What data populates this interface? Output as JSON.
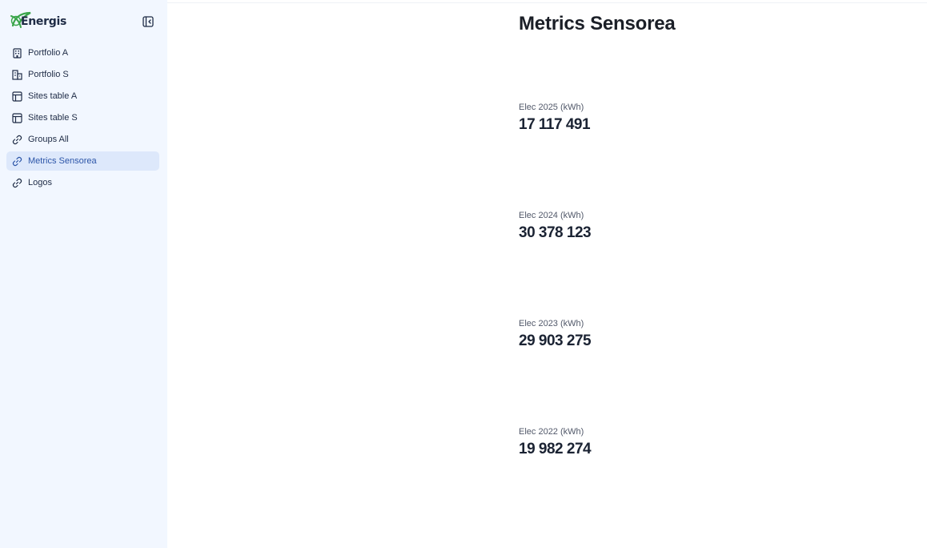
{
  "brand": {
    "name": "Energis"
  },
  "sidebar": {
    "items": [
      {
        "label": "Portfolio A",
        "icon": "building-icon",
        "active": false
      },
      {
        "label": "Portfolio S",
        "icon": "buildings-icon",
        "active": false
      },
      {
        "label": "Sites table A",
        "icon": "table-icon",
        "active": false
      },
      {
        "label": "Sites table S",
        "icon": "table-icon",
        "active": false
      },
      {
        "label": "Groups All",
        "icon": "link-icon",
        "active": false
      },
      {
        "label": "Metrics Sensorea",
        "icon": "link-icon",
        "active": true
      },
      {
        "label": "Logos",
        "icon": "link-icon",
        "active": false
      }
    ]
  },
  "main": {
    "title": "Metrics Sensorea",
    "metrics": [
      {
        "label": "Elec 2025 (kWh)",
        "value": "17 117 491"
      },
      {
        "label": "Elec 2024 (kWh)",
        "value": "30 378 123"
      },
      {
        "label": "Elec 2023 (kWh)",
        "value": "29 903 275"
      },
      {
        "label": "Elec 2022 (kWh)",
        "value": "19 982 274"
      }
    ]
  },
  "colors": {
    "sidebar_bg": "#f2f7ff",
    "active_bg": "#dde8fb",
    "active_text": "#2c55a8",
    "brand_green": "#3aa54a"
  }
}
